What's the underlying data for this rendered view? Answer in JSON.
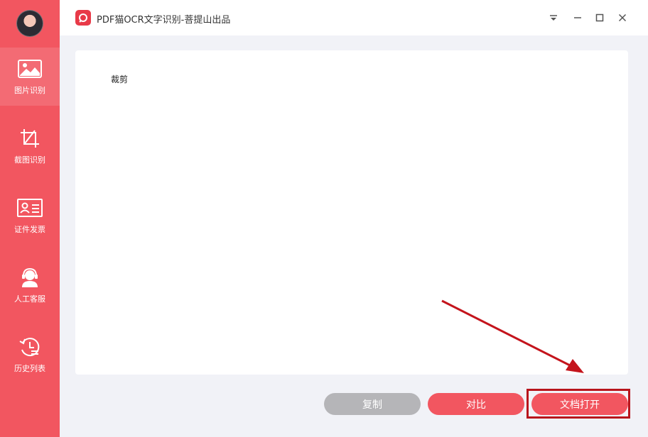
{
  "app": {
    "title": "PDF猫OCR文字识别-菩提山出品"
  },
  "sidebar": {
    "items": [
      {
        "label": "图片识别",
        "icon": "image-icon",
        "active": true
      },
      {
        "label": "截图识别",
        "icon": "crop-icon",
        "active": false
      },
      {
        "label": "证件发票",
        "icon": "id-card-icon",
        "active": false
      },
      {
        "label": "人工客服",
        "icon": "customer-service-icon",
        "active": false
      },
      {
        "label": "历史列表",
        "icon": "history-icon",
        "active": false
      }
    ]
  },
  "window_controls": [
    "dropdown-icon",
    "minimize-icon",
    "maximize-icon",
    "close-icon"
  ],
  "result": {
    "text": "裁剪"
  },
  "buttons": {
    "copy": "复制",
    "compare": "对比",
    "open_doc": "文档打开"
  },
  "colors": {
    "accent": "#f25660",
    "sidebar_active": "#f36b74",
    "grey_button": "#b5b5b8",
    "annotation_red": "#b8151c"
  }
}
